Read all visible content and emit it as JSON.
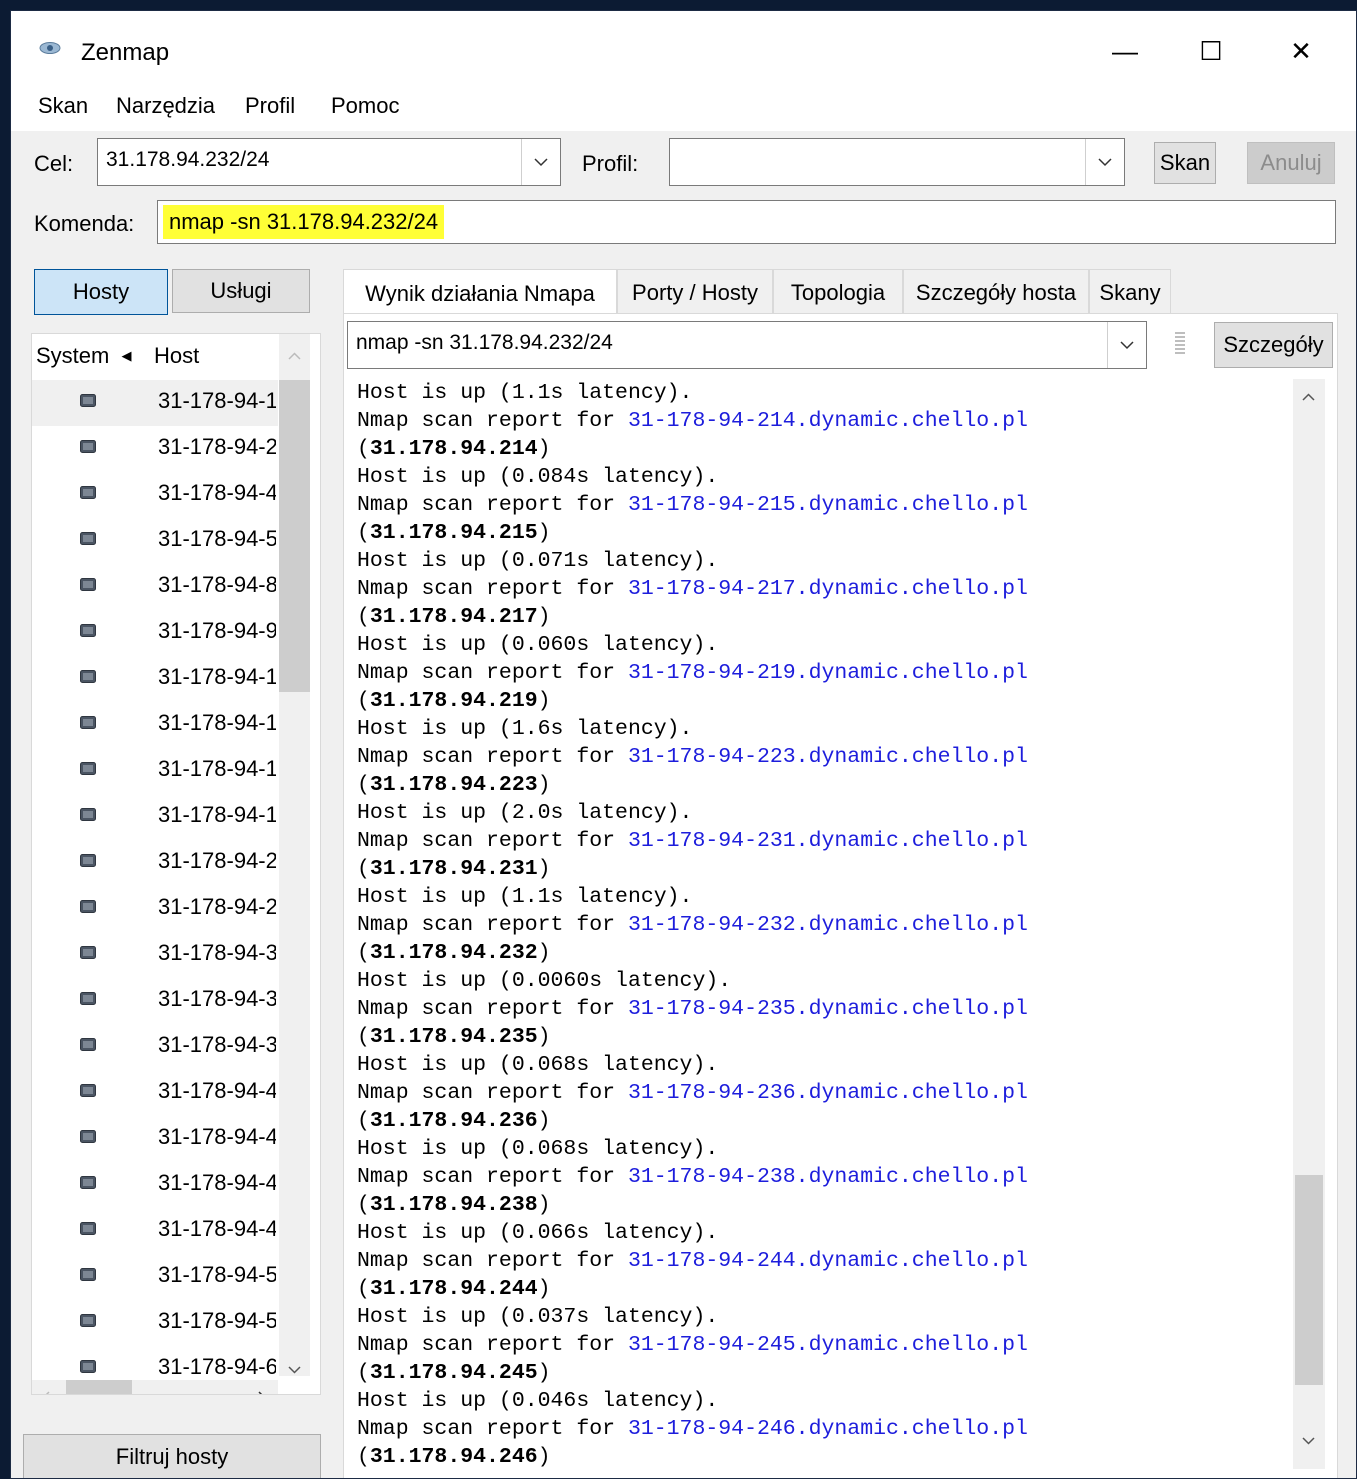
{
  "window": {
    "title": "Zenmap",
    "minimize": "—",
    "maximize": "☐",
    "close": "✕"
  },
  "menu": [
    "Skan",
    "Narzędzia",
    "Profil",
    "Pomoc"
  ],
  "toolbar": {
    "target_label": "Cel:",
    "target_value": "31.178.94.232/24",
    "profile_label": "Profil:",
    "profile_value": "",
    "scan_button": "Skan",
    "cancel_button": "Anuluj",
    "command_label": "Komenda:",
    "command_value": "nmap -sn 31.178.94.232/24"
  },
  "left_panel": {
    "hosts_button": "Hosty",
    "services_button": "Usługi",
    "col_system": "System",
    "col_host": "Host",
    "filter_button": "Filtruj hosty",
    "hosts": [
      "31-178-94-1",
      "31-178-94-2",
      "31-178-94-4",
      "31-178-94-5",
      "31-178-94-8",
      "31-178-94-9",
      "31-178-94-1",
      "31-178-94-1",
      "31-178-94-1",
      "31-178-94-1",
      "31-178-94-2",
      "31-178-94-2",
      "31-178-94-3",
      "31-178-94-3",
      "31-178-94-3",
      "31-178-94-4",
      "31-178-94-4",
      "31-178-94-4",
      "31-178-94-4",
      "31-178-94-5",
      "31-178-94-5",
      "31-178-94-6"
    ]
  },
  "tabs": [
    "Wynik działania Nmapa",
    "Porty / Hosty",
    "Topologia",
    "Szczegóły hosta",
    "Skany"
  ],
  "output_panel": {
    "scan_select": "nmap -sn 31.178.94.232/24",
    "details_button": "Szczegóły",
    "first_line": "Host is up (1.1s latency).",
    "report_prefix": "Nmap scan report for ",
    "entries": [
      {
        "hostname": "31-178-94-214.dynamic.chello.pl",
        "ip": "31.178.94.214",
        "status": "Host is up (0.084s latency)."
      },
      {
        "hostname": "31-178-94-215.dynamic.chello.pl",
        "ip": "31.178.94.215",
        "status": "Host is up (0.071s latency)."
      },
      {
        "hostname": "31-178-94-217.dynamic.chello.pl",
        "ip": "31.178.94.217",
        "status": "Host is up (0.060s latency)."
      },
      {
        "hostname": "31-178-94-219.dynamic.chello.pl",
        "ip": "31.178.94.219",
        "status": "Host is up (1.6s latency)."
      },
      {
        "hostname": "31-178-94-223.dynamic.chello.pl",
        "ip": "31.178.94.223",
        "status": "Host is up (2.0s latency)."
      },
      {
        "hostname": "31-178-94-231.dynamic.chello.pl",
        "ip": "31.178.94.231",
        "status": "Host is up (1.1s latency)."
      },
      {
        "hostname": "31-178-94-232.dynamic.chello.pl",
        "ip": "31.178.94.232",
        "status": "Host is up (0.0060s latency)."
      },
      {
        "hostname": "31-178-94-235.dynamic.chello.pl",
        "ip": "31.178.94.235",
        "status": "Host is up (0.068s latency)."
      },
      {
        "hostname": "31-178-94-236.dynamic.chello.pl",
        "ip": "31.178.94.236",
        "status": "Host is up (0.068s latency)."
      },
      {
        "hostname": "31-178-94-238.dynamic.chello.pl",
        "ip": "31.178.94.238",
        "status": "Host is up (0.066s latency)."
      },
      {
        "hostname": "31-178-94-244.dynamic.chello.pl",
        "ip": "31.178.94.244",
        "status": "Host is up (0.037s latency)."
      },
      {
        "hostname": "31-178-94-245.dynamic.chello.pl",
        "ip": "31.178.94.245",
        "status": "Host is up (0.046s latency)."
      },
      {
        "hostname": "31-178-94-246.dynamic.chello.pl",
        "ip": "31.178.94.246",
        "status": ""
      }
    ]
  },
  "colors": {
    "highlight": "#ffff36",
    "link": "#1d1ddc",
    "active_button": "#cce4f7"
  }
}
